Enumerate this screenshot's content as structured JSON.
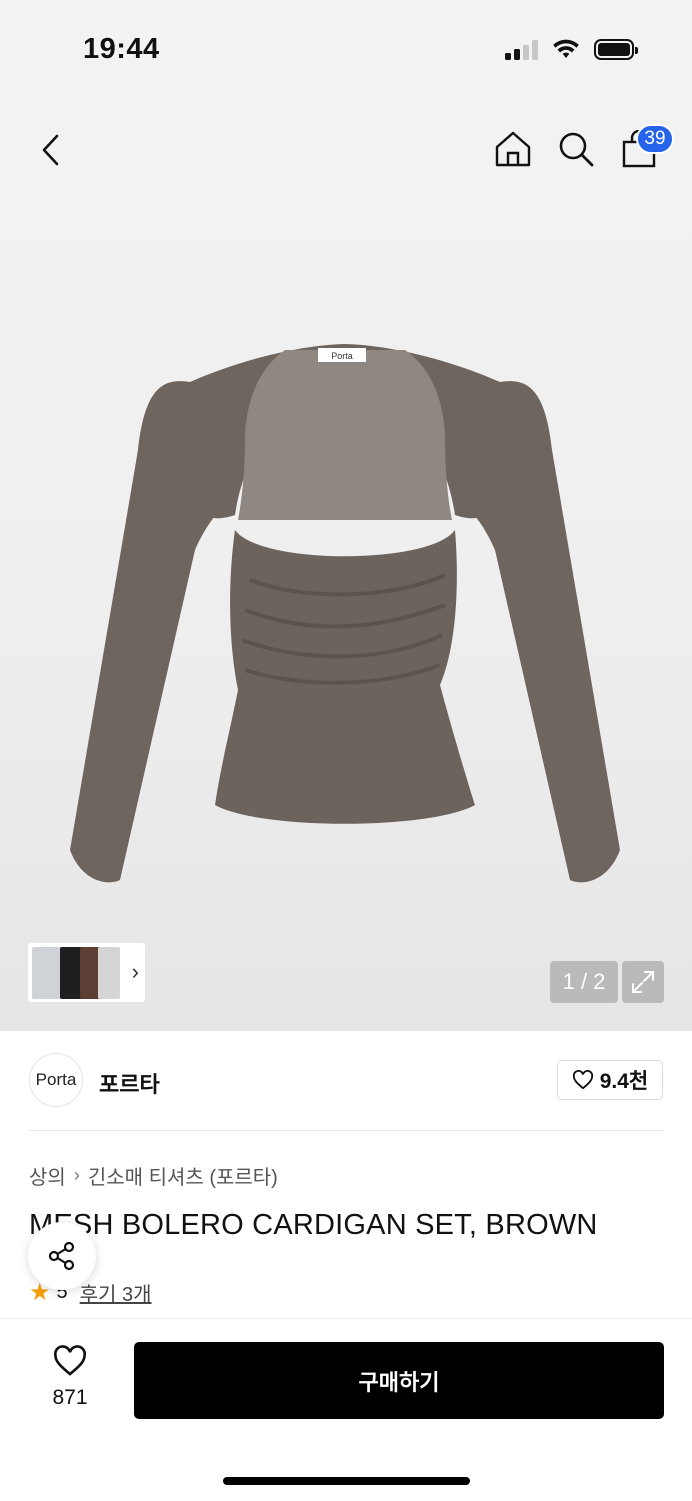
{
  "status_bar": {
    "time": "19:44"
  },
  "header": {
    "cart_count": "39",
    "icons": [
      "back-icon",
      "home-icon",
      "search-icon",
      "cart-icon"
    ]
  },
  "gallery": {
    "counter": "1 / 2",
    "product_tag": "Porta"
  },
  "brand": {
    "logo_text": "Porta",
    "name": "포르타",
    "likes": "9.4천"
  },
  "breadcrumb": [
    "상의",
    "긴소매 티셔츠 (포르타)"
  ],
  "product": {
    "title": "MESH BOLERO CARDIGAN SET, BROWN",
    "rating": "5",
    "reviews_label": "후기 3개"
  },
  "bottom_bar": {
    "wish_count": "871",
    "buy_label": "구매하기"
  },
  "colors": {
    "accent_badge": "#2563eb",
    "garment": "#6e655f",
    "star": "#f59e0b"
  }
}
